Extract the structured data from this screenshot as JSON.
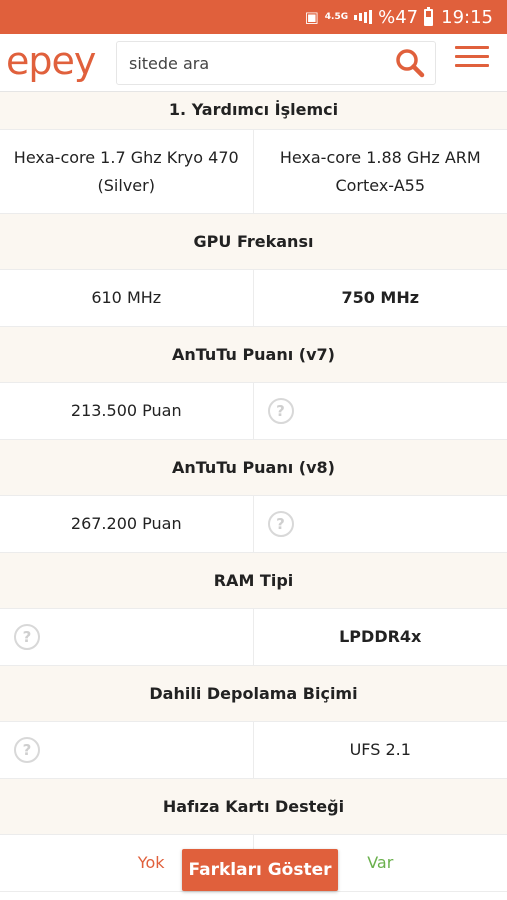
{
  "status_bar": {
    "network": "4.5G",
    "battery": "%47",
    "time": "19:15",
    "colors": {
      "bar": "#e0603c"
    }
  },
  "header": {
    "logo": "epey",
    "search_placeholder": "sitede ara"
  },
  "specs": [
    {
      "title": "1. Yardımcı İşlemci",
      "left": "Hexa-core 1.7 Ghz Kryo 470 (Silver)",
      "right": "Hexa-core 1.88 GHz ARM Cortex-A55"
    },
    {
      "title": "GPU Frekansı",
      "left": "610 MHz",
      "right": "750 MHz"
    },
    {
      "title": "AnTuTu Puanı (v7)",
      "left": "213.500 Puan",
      "right": "?"
    },
    {
      "title": "AnTuTu Puanı (v8)",
      "left": "267.200 Puan",
      "right": "?"
    },
    {
      "title": "RAM Tipi",
      "left": "?",
      "right": "LPDDR4x"
    },
    {
      "title": "Dahili Depolama Biçimi",
      "left": "?",
      "right": "UFS 2.1"
    },
    {
      "title": "Hafıza Kartı Desteği",
      "left": "Yok",
      "right": "Var"
    }
  ],
  "diff_button": "Farkları Göster",
  "colors": {
    "accent": "#e0603c",
    "positive": "#6ab04c",
    "section_bg": "#fbf7f1"
  }
}
